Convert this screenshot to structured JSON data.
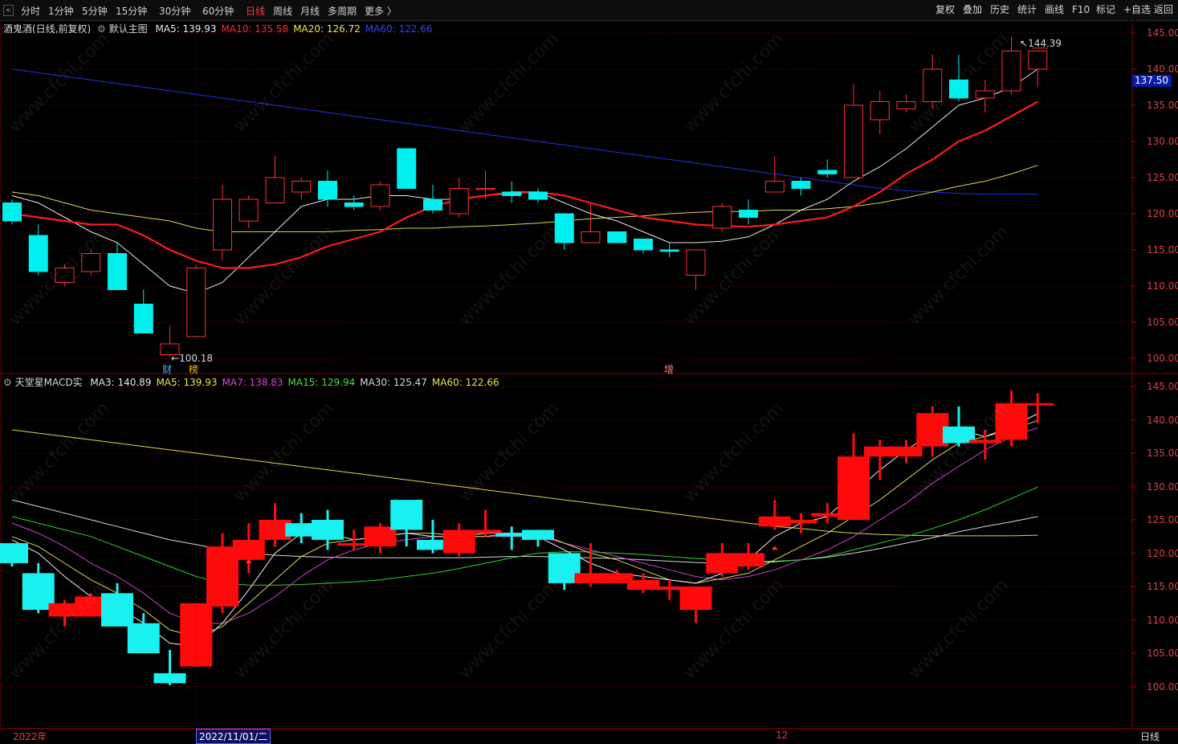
{
  "toolbar": {
    "periods": [
      "分时",
      "1分钟",
      "5分钟",
      "15分钟",
      "30分钟",
      "60分钟",
      "日线",
      "周线",
      "月线",
      "多周期",
      "更多 〉"
    ],
    "active_period": "日线",
    "right_buttons": [
      "复权",
      "叠加",
      "历史",
      "统计",
      "画线",
      "F10",
      "标记",
      "+自选",
      "返回"
    ]
  },
  "main_chart": {
    "title": "酒鬼酒(日线,前复权)",
    "template": "默认主图",
    "ma": [
      {
        "label": "MA5: 139.93",
        "color": "#e8e8e8"
      },
      {
        "label": "MA10: 135.58",
        "color": "#ff2a2a"
      },
      {
        "label": "MA20: 126.72",
        "color": "#e6e64d"
      },
      {
        "label": "MA60: 122.66",
        "color": "#3040ff"
      }
    ],
    "y_ticks": [
      "145.00",
      "140.00",
      "135.00",
      "130.00",
      "125.00",
      "120.00",
      "115.00",
      "110.00",
      "105.00",
      "100.00"
    ],
    "current_price": "137.50",
    "high_label": "144.39",
    "low_label": "100.18",
    "markers": {
      "cai": "财",
      "bang": "榜",
      "zeng": "增"
    }
  },
  "sub_chart": {
    "title": "天堂星MACD实",
    "ma": [
      {
        "label": "MA3: 140.89",
        "color": "#e8e8e8"
      },
      {
        "label": "MA5: 139.93",
        "color": "#e6e64d"
      },
      {
        "label": "MA7: 138.83",
        "color": "#e040e0"
      },
      {
        "label": "MA15: 129.94",
        "color": "#40e040"
      },
      {
        "label": "MA30: 125.47",
        "color": "#d8d8d8"
      },
      {
        "label": "MA60: 122.66",
        "color": "#e6e64d"
      }
    ],
    "y_ticks": [
      "145.00",
      "140.00",
      "135.00",
      "130.00",
      "125.00",
      "120.00",
      "115.00",
      "110.00",
      "105.00",
      "100.00"
    ]
  },
  "bottom": {
    "year": "2022年",
    "cursor_date": "2022/11/01/二",
    "month_mark": "12",
    "period": "日线"
  },
  "watermark": "www.cfchi.com",
  "chart_data": [
    {
      "type": "candlestick",
      "title": "酒鬼酒(日线,前复权)",
      "ylim": [
        99,
        146
      ],
      "candles": [
        {
          "o": 121.5,
          "c": 119.0,
          "h": 122.0,
          "l": 118.5
        },
        {
          "o": 117.0,
          "c": 112.0,
          "h": 118.5,
          "l": 111.5
        },
        {
          "o": 110.5,
          "c": 112.5,
          "h": 113.0,
          "l": 110.0
        },
        {
          "o": 112.0,
          "c": 114.5,
          "h": 115.0,
          "l": 111.5
        },
        {
          "o": 114.5,
          "c": 109.5,
          "h": 116.0,
          "l": 109.5
        },
        {
          "o": 107.5,
          "c": 103.5,
          "h": 109.5,
          "l": 103.5
        },
        {
          "o": 100.5,
          "c": 102.0,
          "h": 104.5,
          "l": 100.2
        },
        {
          "o": 103.0,
          "c": 112.5,
          "h": 113.0,
          "l": 103.0
        },
        {
          "o": 115.0,
          "c": 122.0,
          "h": 124.0,
          "l": 113.5
        },
        {
          "o": 119.0,
          "c": 122.0,
          "h": 122.5,
          "l": 118.0
        },
        {
          "o": 121.5,
          "c": 125.0,
          "h": 128.0,
          "l": 121.5
        },
        {
          "o": 123.0,
          "c": 124.5,
          "h": 125.0,
          "l": 122.0
        },
        {
          "o": 124.5,
          "c": 122.0,
          "h": 126.0,
          "l": 121.0
        },
        {
          "o": 121.5,
          "c": 121.0,
          "h": 122.5,
          "l": 120.5
        },
        {
          "o": 121.0,
          "c": 124.0,
          "h": 124.5,
          "l": 120.5
        },
        {
          "o": 129.0,
          "c": 123.5,
          "h": 129.0,
          "l": 123.5
        },
        {
          "o": 122.0,
          "c": 120.5,
          "h": 124.0,
          "l": 120.0
        },
        {
          "o": 120.0,
          "c": 123.5,
          "h": 125.0,
          "l": 119.5
        },
        {
          "o": 123.5,
          "c": 123.5,
          "h": 126.0,
          "l": 122.0
        },
        {
          "o": 123.0,
          "c": 122.5,
          "h": 124.5,
          "l": 121.5
        },
        {
          "o": 123.0,
          "c": 122.0,
          "h": 123.5,
          "l": 121.5
        },
        {
          "o": 120.0,
          "c": 116.0,
          "h": 120.0,
          "l": 115.0
        },
        {
          "o": 116.0,
          "c": 117.5,
          "h": 121.5,
          "l": 116.0
        },
        {
          "o": 117.5,
          "c": 116.0,
          "h": 117.5,
          "l": 116.0
        },
        {
          "o": 116.5,
          "c": 115.0,
          "h": 116.5,
          "l": 114.5
        },
        {
          "o": 115.0,
          "c": 114.8,
          "h": 116.0,
          "l": 114.0
        },
        {
          "o": 111.5,
          "c": 115.0,
          "h": 115.0,
          "l": 109.5
        },
        {
          "o": 118.0,
          "c": 121.0,
          "h": 121.5,
          "l": 117.5
        },
        {
          "o": 120.5,
          "c": 119.5,
          "h": 122.0,
          "l": 118.5
        },
        {
          "o": 123.0,
          "c": 124.5,
          "h": 128.0,
          "l": 123.0
        },
        {
          "o": 124.5,
          "c": 123.5,
          "h": 125.0,
          "l": 122.5
        },
        {
          "o": 126.0,
          "c": 125.5,
          "h": 127.5,
          "l": 125.0
        },
        {
          "o": 125.0,
          "c": 135.0,
          "h": 138.0,
          "l": 125.0
        },
        {
          "o": 133.0,
          "c": 135.5,
          "h": 137.0,
          "l": 131.0
        },
        {
          "o": 134.5,
          "c": 135.5,
          "h": 136.5,
          "l": 134.0
        },
        {
          "o": 135.5,
          "c": 140.0,
          "h": 142.0,
          "l": 134.5
        },
        {
          "o": 138.5,
          "c": 136.0,
          "h": 142.0,
          "l": 135.5
        },
        {
          "o": 136.0,
          "c": 137.0,
          "h": 138.5,
          "l": 134.0
        },
        {
          "o": 137.0,
          "c": 142.5,
          "h": 144.4,
          "l": 136.5
        },
        {
          "o": 140.0,
          "c": 142.5,
          "h": 142.5,
          "l": 137.5
        }
      ],
      "ma5": [
        122.5,
        121.5,
        119.5,
        117.5,
        116.0,
        113.0,
        110.0,
        109.0,
        110.5,
        114.0,
        117.5,
        121.0,
        122.0,
        122.0,
        122.5,
        122.5,
        122.0,
        122.0,
        122.5,
        122.8,
        123.0,
        121.5,
        120.0,
        119.0,
        117.5,
        116.0,
        116.0,
        116.2,
        116.8,
        118.5,
        120.5,
        122.0,
        124.5,
        126.5,
        129.0,
        132.0,
        135.0,
        136.0,
        137.5,
        140.0
      ],
      "ma10": [
        120.0,
        119.5,
        119.0,
        118.5,
        118.5,
        117.0,
        115.0,
        113.5,
        112.5,
        112.5,
        113.0,
        114.0,
        115.5,
        116.5,
        117.5,
        119.5,
        121.0,
        122.0,
        122.5,
        123.0,
        123.0,
        122.5,
        121.5,
        120.5,
        119.5,
        119.0,
        118.5,
        118.3,
        118.2,
        118.5,
        119.0,
        119.5,
        121.0,
        123.0,
        125.5,
        127.5,
        130.0,
        131.5,
        133.5,
        135.5
      ],
      "ma20": [
        123.0,
        122.5,
        121.5,
        120.5,
        120.0,
        119.5,
        119.0,
        118.0,
        117.5,
        117.5,
        117.5,
        117.5,
        117.5,
        117.7,
        117.8,
        118.0,
        118.0,
        118.2,
        118.3,
        118.5,
        118.7,
        119.0,
        119.3,
        119.5,
        119.7,
        120.0,
        120.2,
        120.3,
        120.3,
        120.5,
        120.5,
        120.7,
        121.0,
        121.5,
        122.2,
        123.0,
        123.8,
        124.5,
        125.5,
        126.7
      ],
      "ma60": [
        140.0,
        139.5,
        139.0,
        138.5,
        138.0,
        137.5,
        137.0,
        136.5,
        136.0,
        135.5,
        135.0,
        134.5,
        134.0,
        133.5,
        133.0,
        132.5,
        132.0,
        131.5,
        131.0,
        130.5,
        130.0,
        129.5,
        129.0,
        128.5,
        128.0,
        127.5,
        127.0,
        126.5,
        126.0,
        125.5,
        125.0,
        124.5,
        124.0,
        123.5,
        123.2,
        123.0,
        122.8,
        122.7,
        122.7,
        122.7
      ]
    },
    {
      "type": "candlestick",
      "title": "天堂星MACD实",
      "ylim": [
        98.5,
        146.5
      ],
      "candles": [
        {
          "o": 121.5,
          "c": 118.5,
          "h": 121.5,
          "l": 118.0
        },
        {
          "o": 117.0,
          "c": 111.5,
          "h": 118.5,
          "l": 111.0
        },
        {
          "o": 110.5,
          "c": 112.5,
          "h": 113.0,
          "l": 109.0
        },
        {
          "o": 110.5,
          "c": 113.5,
          "h": 114.0,
          "l": 110.5
        },
        {
          "o": 114.0,
          "c": 109.0,
          "h": 115.5,
          "l": 109.0
        },
        {
          "o": 109.5,
          "c": 105.0,
          "h": 111.0,
          "l": 105.0
        },
        {
          "o": 102.0,
          "c": 100.5,
          "h": 105.5,
          "l": 100.2
        },
        {
          "o": 103.0,
          "c": 112.5,
          "h": 112.5,
          "l": 103.0
        },
        {
          "o": 112.0,
          "c": 121.0,
          "h": 123.0,
          "l": 111.0
        },
        {
          "o": 119.0,
          "c": 122.0,
          "h": 124.5,
          "l": 117.0
        },
        {
          "o": 122.0,
          "c": 125.0,
          "h": 127.5,
          "l": 121.0
        },
        {
          "o": 124.5,
          "c": 122.5,
          "h": 126.0,
          "l": 121.5
        },
        {
          "o": 125.0,
          "c": 122.0,
          "h": 126.5,
          "l": 120.5
        },
        {
          "o": 121.5,
          "c": 121.5,
          "h": 123.5,
          "l": 120.5
        },
        {
          "o": 121.0,
          "c": 124.0,
          "h": 124.5,
          "l": 120.0
        },
        {
          "o": 128.0,
          "c": 123.5,
          "h": 128.0,
          "l": 121.0
        },
        {
          "o": 122.0,
          "c": 120.5,
          "h": 125.0,
          "l": 120.0
        },
        {
          "o": 120.0,
          "c": 123.5,
          "h": 124.5,
          "l": 119.5
        },
        {
          "o": 123.0,
          "c": 123.5,
          "h": 126.5,
          "l": 122.5
        },
        {
          "o": 123.0,
          "c": 122.5,
          "h": 124.0,
          "l": 120.5
        },
        {
          "o": 123.5,
          "c": 122.0,
          "h": 123.5,
          "l": 121.0
        },
        {
          "o": 120.0,
          "c": 115.5,
          "h": 120.0,
          "l": 114.5
        },
        {
          "o": 115.5,
          "c": 117.0,
          "h": 121.5,
          "l": 115.0
        },
        {
          "o": 115.5,
          "c": 117.0,
          "h": 117.5,
          "l": 115.5
        },
        {
          "o": 114.5,
          "c": 116.0,
          "h": 117.0,
          "l": 114.0
        },
        {
          "o": 114.5,
          "c": 115.0,
          "h": 116.0,
          "l": 113.0
        },
        {
          "o": 111.5,
          "c": 115.0,
          "h": 115.0,
          "l": 109.5
        },
        {
          "o": 117.0,
          "c": 120.0,
          "h": 121.5,
          "l": 116.5
        },
        {
          "o": 118.0,
          "c": 120.0,
          "h": 121.5,
          "l": 117.5
        },
        {
          "o": 124.0,
          "c": 125.5,
          "h": 128.0,
          "l": 123.5
        },
        {
          "o": 124.5,
          "c": 125.0,
          "h": 126.0,
          "l": 123.0
        },
        {
          "o": 125.5,
          "c": 126.0,
          "h": 127.5,
          "l": 124.5
        },
        {
          "o": 125.0,
          "c": 134.5,
          "h": 138.0,
          "l": 125.0
        },
        {
          "o": 134.5,
          "c": 136.0,
          "h": 137.0,
          "l": 131.0
        },
        {
          "o": 134.5,
          "c": 136.0,
          "h": 137.0,
          "l": 133.5
        },
        {
          "o": 136.0,
          "c": 141.0,
          "h": 142.0,
          "l": 134.5
        },
        {
          "o": 139.0,
          "c": 136.5,
          "h": 142.0,
          "l": 136.0
        },
        {
          "o": 136.5,
          "c": 137.0,
          "h": 138.5,
          "l": 134.0
        },
        {
          "o": 137.0,
          "c": 142.5,
          "h": 144.4,
          "l": 136.0
        },
        {
          "o": 142.5,
          "c": 142.5,
          "h": 144.0,
          "l": 139.5
        }
      ],
      "ma3": [
        122.0,
        120.0,
        116.5,
        113.5,
        112.0,
        109.5,
        106.5,
        106.0,
        109.5,
        114.5,
        120.0,
        123.0,
        123.0,
        122.0,
        122.5,
        123.0,
        122.5,
        122.5,
        123.0,
        123.0,
        122.5,
        120.5,
        118.5,
        117.0,
        116.5,
        116.0,
        115.5,
        117.0,
        119.0,
        122.5,
        124.5,
        125.5,
        129.0,
        132.5,
        135.5,
        138.0,
        138.5,
        137.5,
        139.0,
        140.9
      ],
      "ma5": [
        122.5,
        121.0,
        118.5,
        116.0,
        114.0,
        111.5,
        108.5,
        107.5,
        109.0,
        112.5,
        116.0,
        119.5,
        121.5,
        122.0,
        122.5,
        123.0,
        123.0,
        122.5,
        122.5,
        123.0,
        123.0,
        121.5,
        120.0,
        119.0,
        117.5,
        116.0,
        115.5,
        116.2,
        117.0,
        119.0,
        121.0,
        123.0,
        125.5,
        128.0,
        131.0,
        134.0,
        136.5,
        137.5,
        138.5,
        139.9
      ],
      "ma7": [
        124.5,
        123.0,
        121.0,
        118.5,
        116.5,
        114.0,
        111.0,
        109.5,
        109.5,
        111.0,
        113.5,
        116.5,
        119.0,
        120.5,
        121.5,
        122.0,
        122.5,
        122.5,
        122.5,
        122.5,
        122.5,
        121.5,
        120.5,
        119.5,
        118.5,
        117.5,
        116.5,
        116.0,
        116.5,
        117.5,
        119.0,
        120.5,
        122.5,
        125.0,
        127.5,
        130.5,
        133.0,
        135.5,
        137.5,
        138.8
      ],
      "ma15": [
        125.5,
        124.5,
        123.5,
        122.5,
        121.0,
        119.5,
        118.0,
        116.5,
        115.5,
        115.2,
        115.2,
        115.3,
        115.5,
        115.7,
        116.0,
        116.5,
        117.0,
        117.7,
        118.5,
        119.3,
        120.0,
        120.2,
        120.2,
        120.0,
        119.8,
        119.5,
        119.2,
        119.0,
        118.8,
        118.8,
        119.0,
        119.5,
        120.5,
        121.5,
        122.5,
        123.7,
        125.0,
        126.5,
        128.2,
        129.9
      ],
      "ma30": [
        128.0,
        127.0,
        126.0,
        125.0,
        124.0,
        123.0,
        122.0,
        121.3,
        120.5,
        120.0,
        119.7,
        119.5,
        119.4,
        119.3,
        119.3,
        119.3,
        119.3,
        119.3,
        119.4,
        119.5,
        119.5,
        119.4,
        119.3,
        119.2,
        119.0,
        118.8,
        118.6,
        118.5,
        118.5,
        118.7,
        119.0,
        119.4,
        120.0,
        120.7,
        121.5,
        122.3,
        123.2,
        124.0,
        124.7,
        125.5
      ],
      "ma60": [
        138.5,
        138.0,
        137.5,
        137.0,
        136.5,
        136.0,
        135.5,
        135.0,
        134.5,
        134.0,
        133.5,
        133.0,
        132.5,
        132.0,
        131.5,
        131.0,
        130.5,
        130.0,
        129.5,
        129.0,
        128.5,
        128.0,
        127.5,
        127.0,
        126.5,
        126.0,
        125.5,
        125.0,
        124.5,
        124.0,
        123.7,
        123.3,
        123.0,
        122.8,
        122.7,
        122.6,
        122.6,
        122.6,
        122.6,
        122.7
      ]
    }
  ]
}
